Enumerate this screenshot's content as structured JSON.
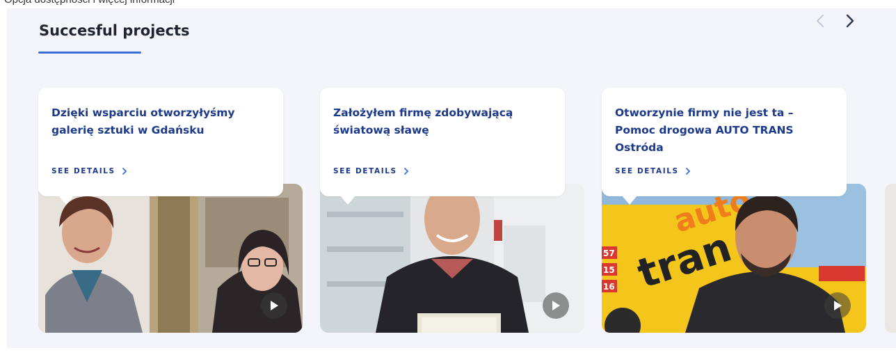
{
  "top_cut_text": "Opcja dostępności i więcej informacji",
  "section": {
    "title": "Succesful projects",
    "prev_label": "‹",
    "next_label": "›"
  },
  "cards": [
    {
      "title": "Dzięki wsparciu otworzyłyśmy galerię sztuki w Gdańsku",
      "see_details": "SEE DETAILS",
      "photo_icon": "photo-two-women-art-gallery",
      "play_icon": "play-icon"
    },
    {
      "title": "Założyłem firmę zdobywającą światową sławę",
      "see_details": "SEE DETAILS",
      "photo_icon": "photo-man-in-laboratory",
      "play_icon": "play-icon"
    },
    {
      "title": "Otworzynie firmy nie jest ta – Pomoc drogowa AUTO TRANS Ostróda",
      "see_details": "SEE DETAILS",
      "photo_icon": "photo-man-with-tow-truck",
      "play_icon": "play-icon",
      "truck_text": "auto trans"
    }
  ],
  "colors": {
    "accent": "#3a6fdc",
    "card_title": "#1d3a8a",
    "background": "#f3f5fa"
  }
}
